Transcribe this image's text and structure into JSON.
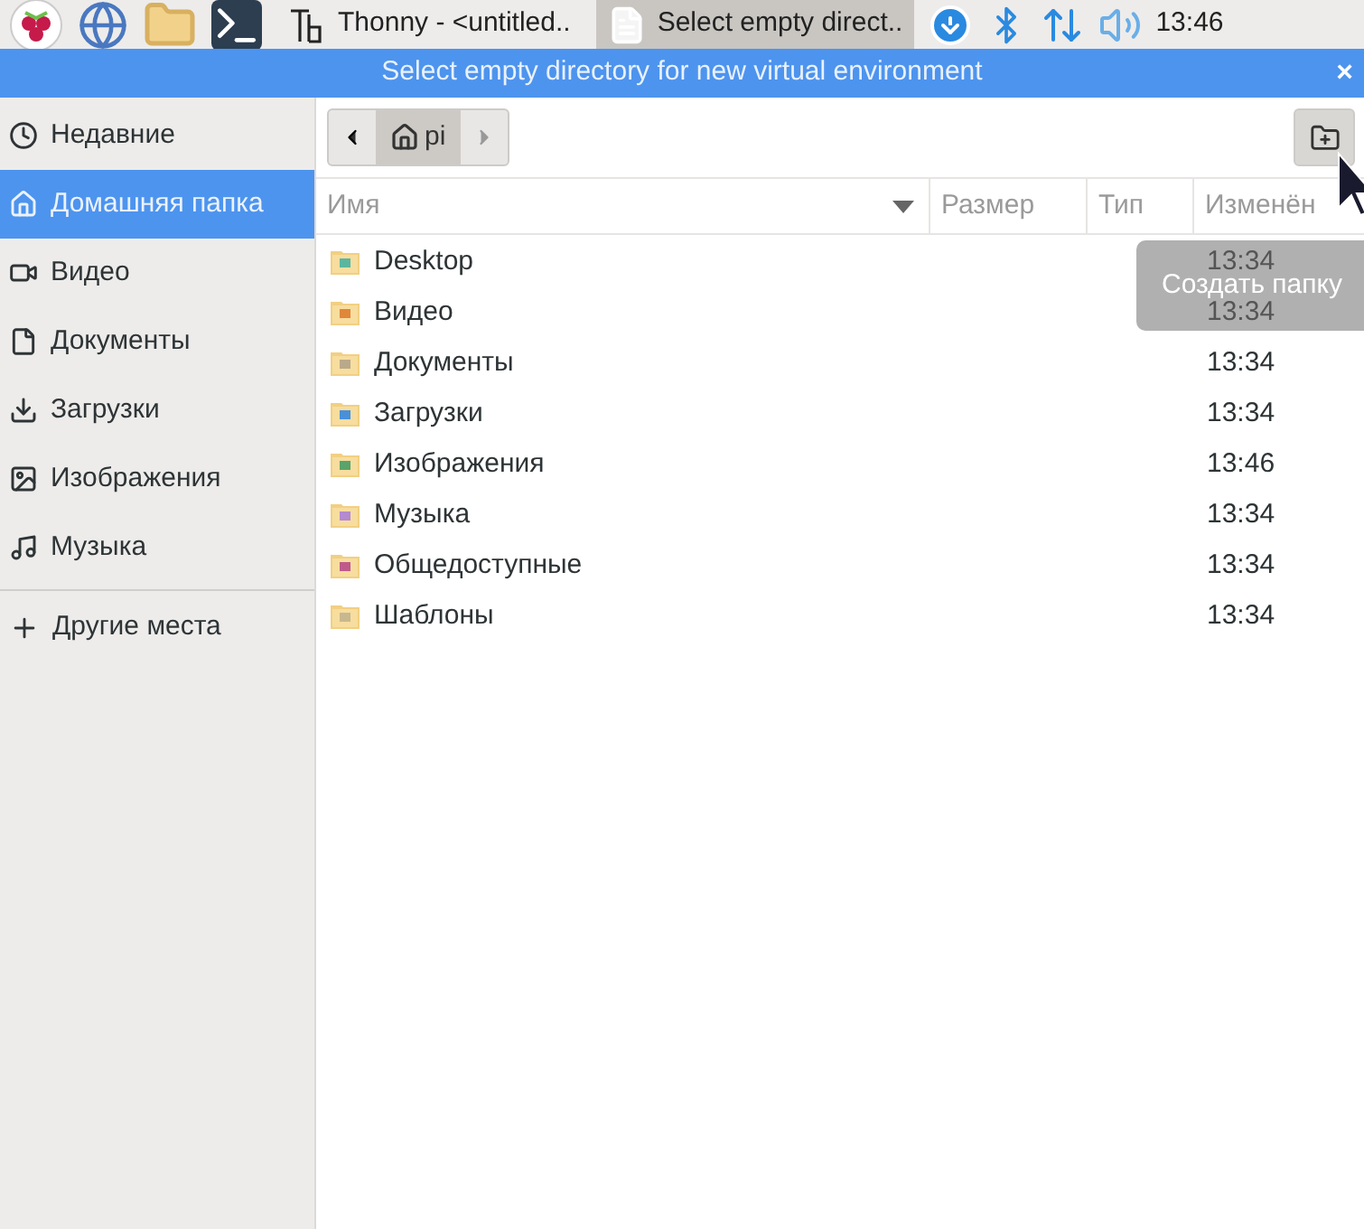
{
  "taskbar": {
    "tasks": [
      {
        "kind": "thonny",
        "label": "Thonny  -  <untitled..",
        "selected": false
      },
      {
        "kind": "document",
        "label": "Select empty direct..",
        "selected": true
      }
    ],
    "clock": "13:46"
  },
  "window": {
    "title": "Select empty directory for new virtual environment",
    "close": "×"
  },
  "sidebar": {
    "items": [
      {
        "kind": "clock",
        "label": "Недавние",
        "selected": false
      },
      {
        "kind": "home",
        "label": "Домашняя папка",
        "selected": true
      },
      {
        "kind": "video",
        "label": "Видео",
        "selected": false
      },
      {
        "kind": "document",
        "label": "Документы",
        "selected": false
      },
      {
        "kind": "download",
        "label": "Загрузки",
        "selected": false
      },
      {
        "kind": "image",
        "label": "Изображения",
        "selected": false
      },
      {
        "kind": "music",
        "label": "Музыка",
        "selected": false
      }
    ],
    "other": {
      "label": "Другие места"
    }
  },
  "path_bar": {
    "crumbs": [
      {
        "label": "pi",
        "selected": true
      }
    ]
  },
  "tooltip": "Создать папку",
  "table": {
    "columns": [
      "Имя",
      "Размер",
      "Тип",
      "Изменён"
    ],
    "rows": [
      {
        "kind": "desktop",
        "name": "Desktop",
        "modified": "13:34"
      },
      {
        "kind": "video",
        "name": "Видео",
        "modified": "13:34"
      },
      {
        "kind": "documents",
        "name": "Документы",
        "modified": "13:34"
      },
      {
        "kind": "downloads",
        "name": "Загрузки",
        "modified": "13:34"
      },
      {
        "kind": "pictures",
        "name": "Изображения",
        "modified": "13:46"
      },
      {
        "kind": "music",
        "name": "Музыка",
        "modified": "13:34"
      },
      {
        "kind": "public",
        "name": "Общедоступные",
        "modified": "13:34"
      },
      {
        "kind": "templates",
        "name": "Шаблоны",
        "modified": "13:34"
      }
    ]
  }
}
